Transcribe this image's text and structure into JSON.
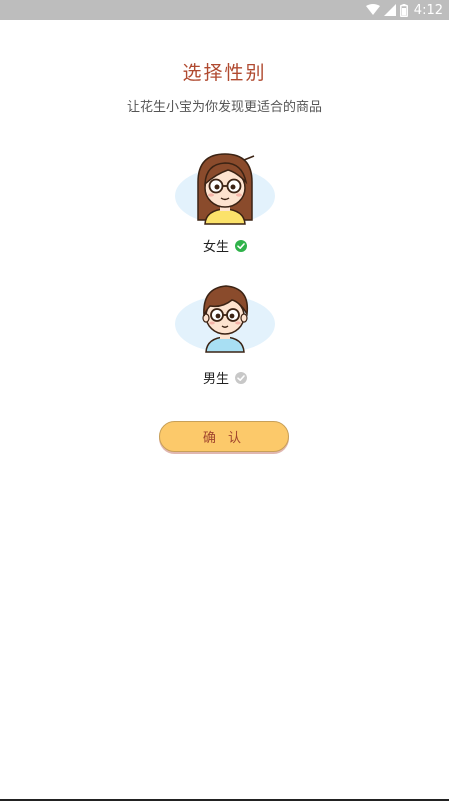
{
  "status_bar": {
    "time": "4:12",
    "icons": [
      "wifi-icon",
      "signal-icon",
      "battery-icon"
    ]
  },
  "header": {
    "title": "选择性别",
    "subtitle": "让花生小宝为你发现更适合的商品"
  },
  "options": [
    {
      "label": "女生",
      "selected": true,
      "avatar": "girl-avatar-icon"
    },
    {
      "label": "男生",
      "selected": false,
      "avatar": "boy-avatar-icon"
    }
  ],
  "confirm_button": {
    "label": "确 认"
  },
  "colors": {
    "title": "#b04a30",
    "button_fill": "#fcc96a",
    "check_selected": "#2fb24a",
    "check_unselected": "#c8c8c8",
    "avatar_bg": "#e3f2fc"
  }
}
